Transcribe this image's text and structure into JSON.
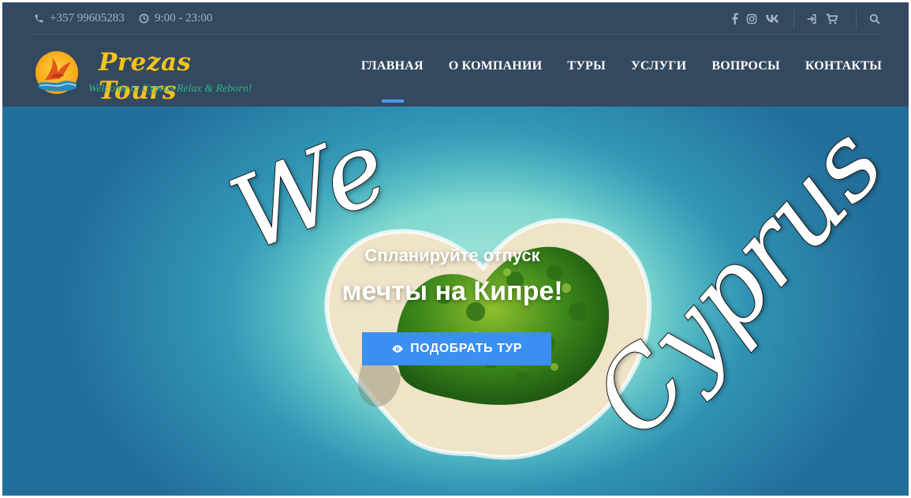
{
  "topbar": {
    "phone": "+357 99605283",
    "hours": "9:00 - 23:00",
    "social_icons": [
      "facebook-icon",
      "instagram-icon",
      "vk-icon"
    ],
    "utility_icons": [
      "login-icon",
      "cart-icon",
      "search-icon"
    ]
  },
  "logo": {
    "title": "Prezas Tours",
    "tagline": "Welcome to Cyprus Relax & Reborn!"
  },
  "nav": {
    "items": [
      {
        "label": "ГЛАВНАЯ",
        "active": true
      },
      {
        "label": "О КОМПАНИИ",
        "active": false
      },
      {
        "label": "ТУРЫ",
        "active": false
      },
      {
        "label": "УСЛУГИ",
        "active": false
      },
      {
        "label": "ВОПРОСЫ",
        "active": false
      },
      {
        "label": "КОНТАКТЫ",
        "active": false
      }
    ]
  },
  "hero": {
    "line1": "Спланируйте отпуск",
    "line2": "мечты на Кипре!",
    "cta_label": "ПОДОБРАТЬ ТУР",
    "cta_icon": "eye-icon",
    "script_word_1": "We",
    "script_word_2": "Cyprus"
  },
  "colors": {
    "header_bg": "#33495f",
    "accent": "#3b8ff0",
    "logo_gold": "#f4c21c",
    "logo_green": "#2fb48a"
  }
}
